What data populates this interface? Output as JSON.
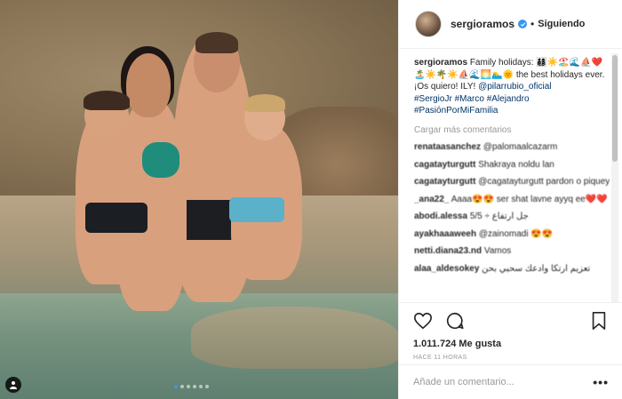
{
  "post": {
    "username": "sergioramos",
    "separator": "•",
    "follow_label": "Siguiendo",
    "caption_user": "sergioramos",
    "caption_text": "Family holidays: 👨‍👩‍👦‍👦☀️🏖️🌊⛵❤️🏝️☀️🌴☀️⛵🌊🌅🏊‍♂️🌞 the best holidays ever.",
    "caption_line2": "¡Os quiero! ILY!",
    "caption_mention": "@pilarrubio_oficial",
    "caption_tags": "#SergioJr #Marco #Alejandro #PasiónPorMiFamilia",
    "load_more": "Cargar más comentarios",
    "comments": [
      {
        "user": "renataasanchez",
        "text": "@palomaalcazarm"
      },
      {
        "user": "cagatayturgutt",
        "text": "Shakraya noldu lan"
      },
      {
        "user": "cagatayturgutt",
        "text": "@cagatayturgutt pardon o piqueydi"
      },
      {
        "user": "_ana22_",
        "text": "Aaaa😍😍 ser shat lavne ayyq ee❤️❤️ (nenc em grum yani hesa jokelu en)"
      },
      {
        "user": "abodi.alessa",
        "text": "5/5 ÷ جل ارتفاع"
      },
      {
        "user": "ayakhaaaweeh",
        "text": "@zainomadi 😍😍"
      },
      {
        "user": "netti.diana23.nd",
        "text": "Vamos"
      },
      {
        "user": "alaa_aldesokey",
        "text": "تعزيم ارتكا وادعك سحبي بحن"
      }
    ],
    "likes": "1.011.724 Me gusta",
    "time": "HACE 11 HORAS",
    "comment_placeholder": "Añade un comentario...",
    "more_options": "•••"
  },
  "icons": {
    "like": "heart-icon",
    "comment": "comment-icon",
    "save": "bookmark-icon",
    "tagged_users": "user-tag-icon",
    "verified": "verified-badge-icon",
    "options": "more-options-icon"
  },
  "colors": {
    "link": "#003569",
    "verified": "#3897f0",
    "muted": "#999999",
    "border": "#efefef"
  },
  "carousel": {
    "total": 6,
    "active": 1
  }
}
